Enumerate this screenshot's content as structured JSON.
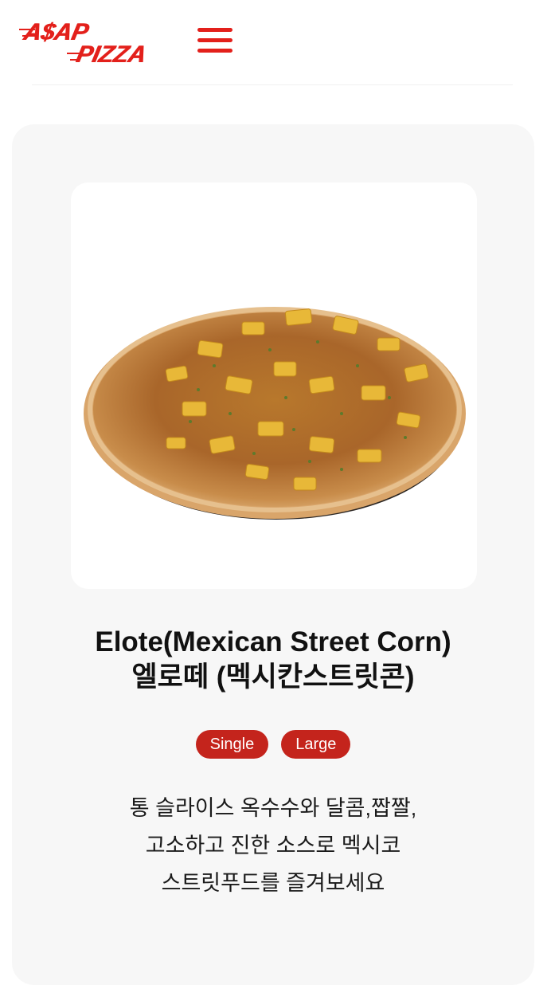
{
  "header": {
    "logo_line_1": "A$AP",
    "logo_line_2": "PIZZA",
    "menu_icon": "hamburger-menu-icon",
    "brand_color": "#e3201b"
  },
  "product": {
    "image": "elote-pizza-photo",
    "title_en": "Elote(Mexican Street Corn)",
    "title_ko": "엘로떼 (멕시칸스트릿콘)",
    "sizes": [
      "Single",
      "Large"
    ],
    "badge_color": "#c4241c",
    "description_lines": [
      "통 슬라이스 옥수수와 달콤,짭짤,",
      "고소하고 진한 소스로 멕시코",
      "스트릿푸드를 즐겨보세요"
    ]
  }
}
